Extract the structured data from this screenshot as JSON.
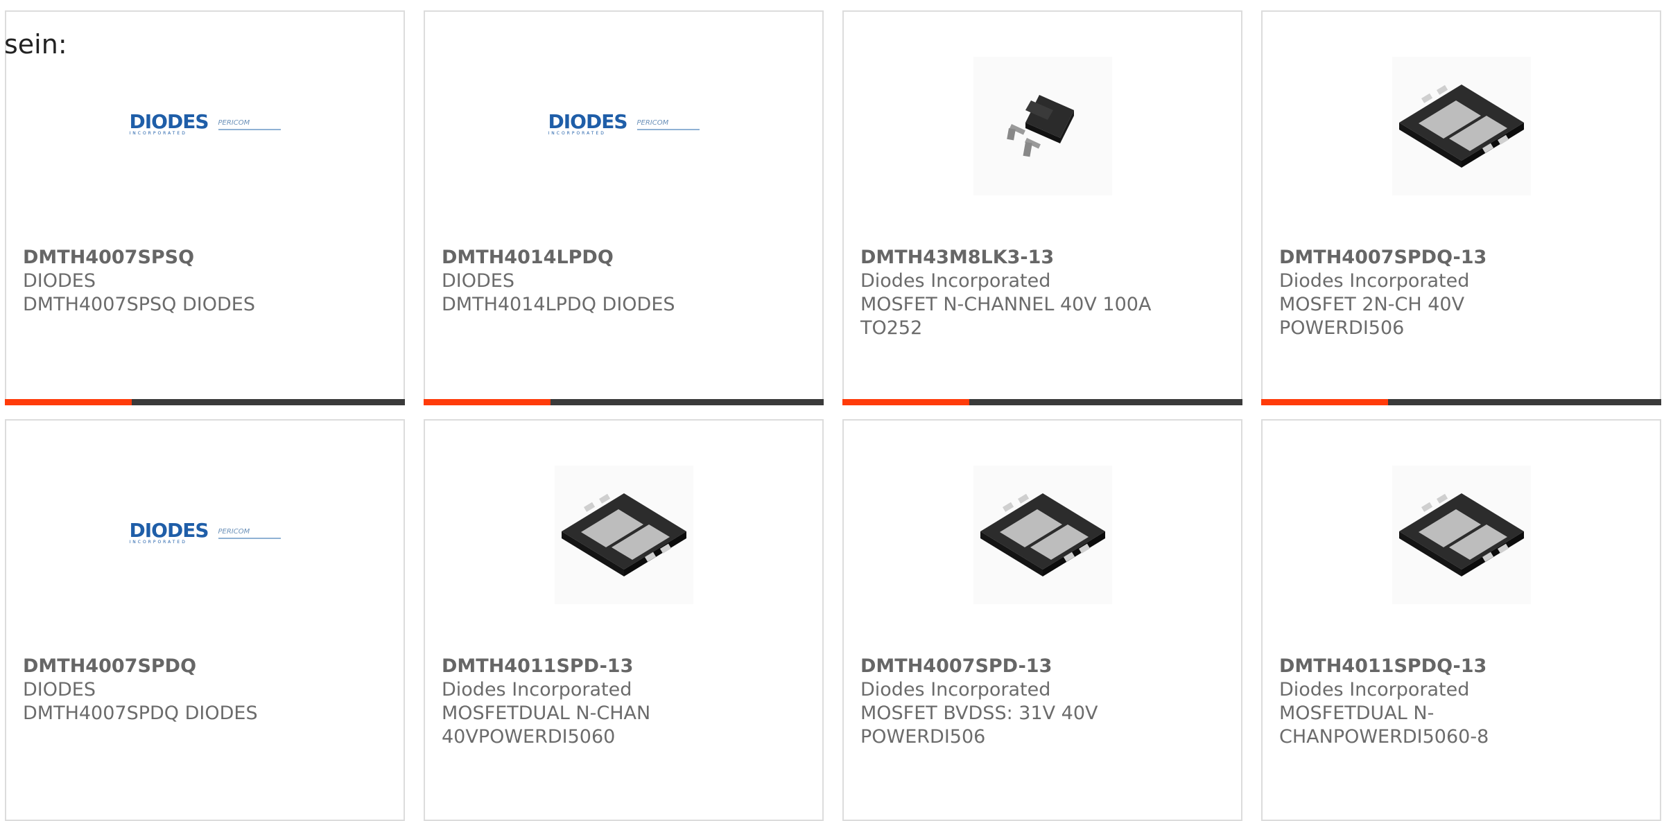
{
  "heading": "sein:",
  "logo": {
    "brand": "DIODES",
    "brand_small": "INCORPORATED",
    "partner": "PERICOM"
  },
  "cards": [
    {
      "part_number": "DMTH4007SPSQ",
      "manufacturer": "DIODES",
      "description": "DMTH4007SPSQ DIODES",
      "image": "diodes-logo"
    },
    {
      "part_number": "DMTH4014LPDQ",
      "manufacturer": "DIODES",
      "description": "DMTH4014LPDQ DIODES",
      "image": "diodes-logo"
    },
    {
      "part_number": "DMTH43M8LK3-13",
      "manufacturer": "Diodes Incorporated",
      "description": "MOSFET N-CHANNEL 40V 100A TO252",
      "image": "to252-package"
    },
    {
      "part_number": "DMTH4007SPDQ-13",
      "manufacturer": "Diodes Incorporated",
      "description": "MOSFET 2N-CH 40V POWERDI506",
      "image": "powerdi-package"
    },
    {
      "part_number": "DMTH4007SPDQ",
      "manufacturer": "DIODES",
      "description": "DMTH4007SPDQ DIODES",
      "image": "diodes-logo"
    },
    {
      "part_number": "DMTH4011SPD-13",
      "manufacturer": "Diodes Incorporated",
      "description": "MOSFETDUAL N-CHAN 40VPOWERDI5060",
      "image": "powerdi-package"
    },
    {
      "part_number": "DMTH4007SPD-13",
      "manufacturer": "Diodes Incorporated",
      "description": "MOSFET BVDSS: 31V 40V POWERDI506",
      "image": "powerdi-package"
    },
    {
      "part_number": "DMTH4011SPDQ-13",
      "manufacturer": "Diodes Incorporated",
      "description": "MOSFETDUAL N-CHANPOWERDI5060-8",
      "image": "powerdi-package"
    }
  ],
  "colors": {
    "accent": "#ff3b0a",
    "bar": "#3a3a3a",
    "border": "#dcdcdc",
    "text": "#6b6b6b",
    "logo_blue": "#1f5ea8"
  }
}
